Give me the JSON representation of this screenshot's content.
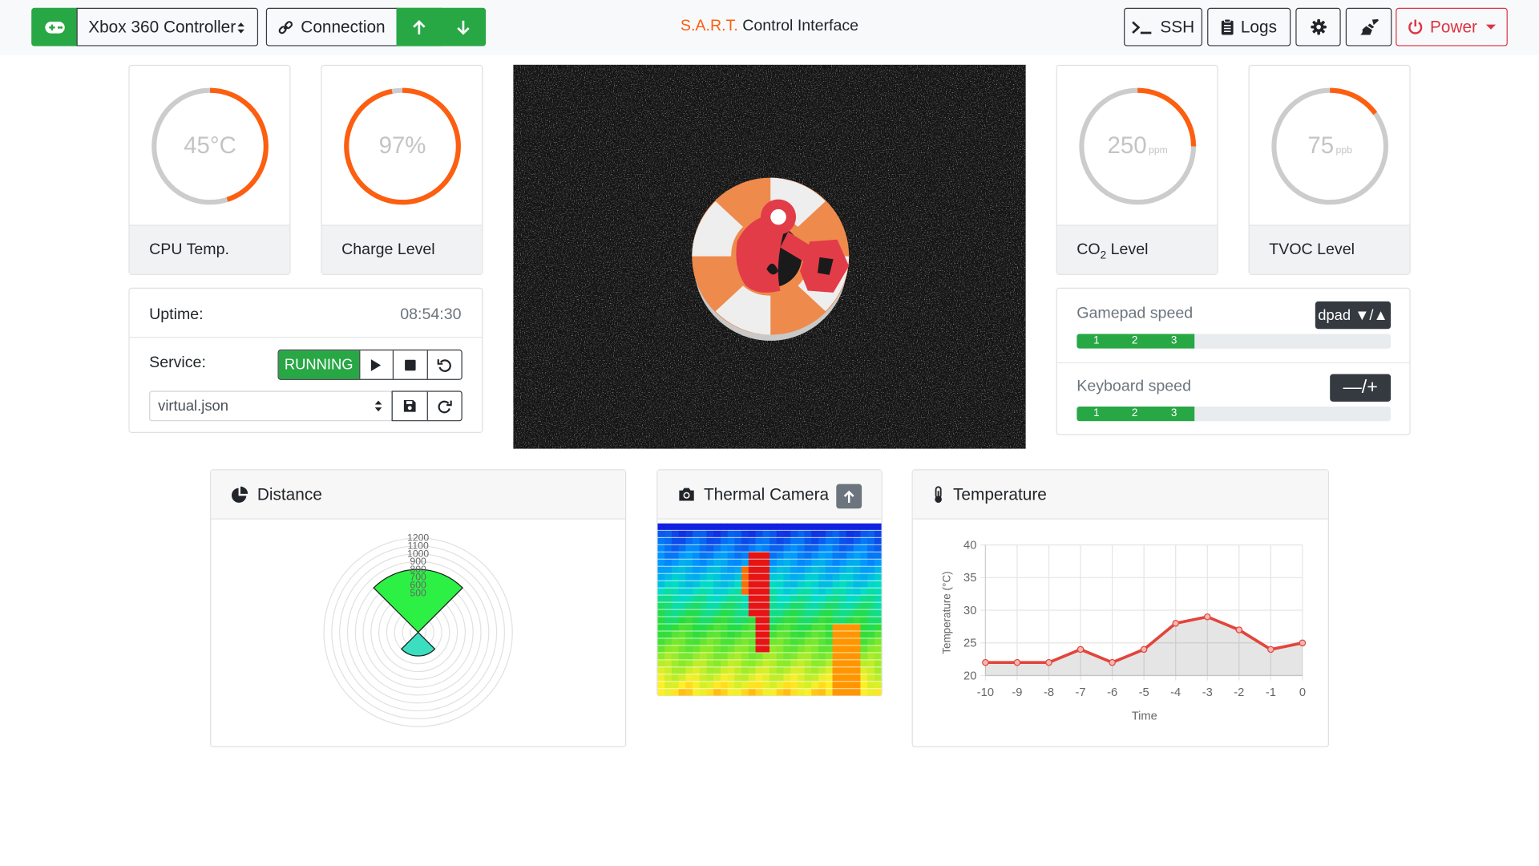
{
  "navbar": {
    "controller_label": "Xbox 360 Controller",
    "connection_label": "Connection",
    "title_brand": "S.A.R.T.",
    "title_rest": " Control Interface",
    "ssh_label": "SSH",
    "logs_label": "Logs",
    "power_label": "Power"
  },
  "gauges": {
    "cpu": {
      "value": "45°C",
      "unit": "",
      "label": "CPU Temp.",
      "fraction": 0.45
    },
    "charge": {
      "value": "97%",
      "unit": "",
      "label": "Charge Level",
      "fraction": 0.97
    },
    "co2": {
      "value": "250",
      "unit": "ppm",
      "label_main": "CO",
      "label_sub": "2",
      "label_rest": " Level",
      "fraction": 0.25
    },
    "tvoc": {
      "value": "75",
      "unit": "ppb",
      "label": "TVOC Level",
      "fraction": 0.15
    }
  },
  "status": {
    "uptime_label": "Uptime:",
    "uptime_value": "08:54:30",
    "service_label": "Service:",
    "service_state": "RUNNING",
    "config_file": "virtual.json"
  },
  "speeds": {
    "gamepad_label": "Gamepad speed",
    "gamepad_badge": "dpad ▼/▲",
    "keyboard_label": "Keyboard speed",
    "keyboard_badge": "—/+",
    "gamepad_level_fraction": 0.375,
    "keyboard_level_fraction": 0.375,
    "marks": [
      "1",
      "2",
      "3"
    ]
  },
  "panels": {
    "distance_title": "Distance",
    "thermal_title": "Thermal Camera",
    "temperature_title": "Temperature"
  },
  "colors": {
    "accent": "#fd5e0f",
    "success": "#28a745",
    "danger": "#dc3545",
    "dark": "#343a40",
    "line": "#e2453b"
  },
  "distance_chart": {
    "radial_labels": [
      "1200",
      "1100",
      "1000",
      "900",
      "800",
      "700",
      "600",
      "500"
    ],
    "sector_green_range": [
      -45,
      45
    ],
    "sector_green_radius": 800,
    "sector_teal_range": [
      135,
      225
    ],
    "sector_teal_radius": 300,
    "max": 1200
  },
  "chart_data": {
    "type": "line",
    "title": "",
    "xlabel": "Time",
    "ylabel": "Temperature (°C)",
    "x": [
      -10,
      -9,
      -8,
      -7,
      -6,
      -5,
      -4,
      -3,
      -2,
      -1,
      0
    ],
    "values": [
      22,
      22,
      22,
      24,
      22,
      24,
      28,
      29,
      27,
      24,
      25
    ],
    "ylim": [
      20,
      40
    ],
    "yticks": [
      "20",
      "25",
      "30",
      "35",
      "40"
    ],
    "xticks": [
      "-10",
      "-9",
      "-8",
      "-7",
      "-6",
      "-5",
      "-4",
      "-3",
      "-2",
      "-1",
      "0"
    ],
    "grid": true
  }
}
